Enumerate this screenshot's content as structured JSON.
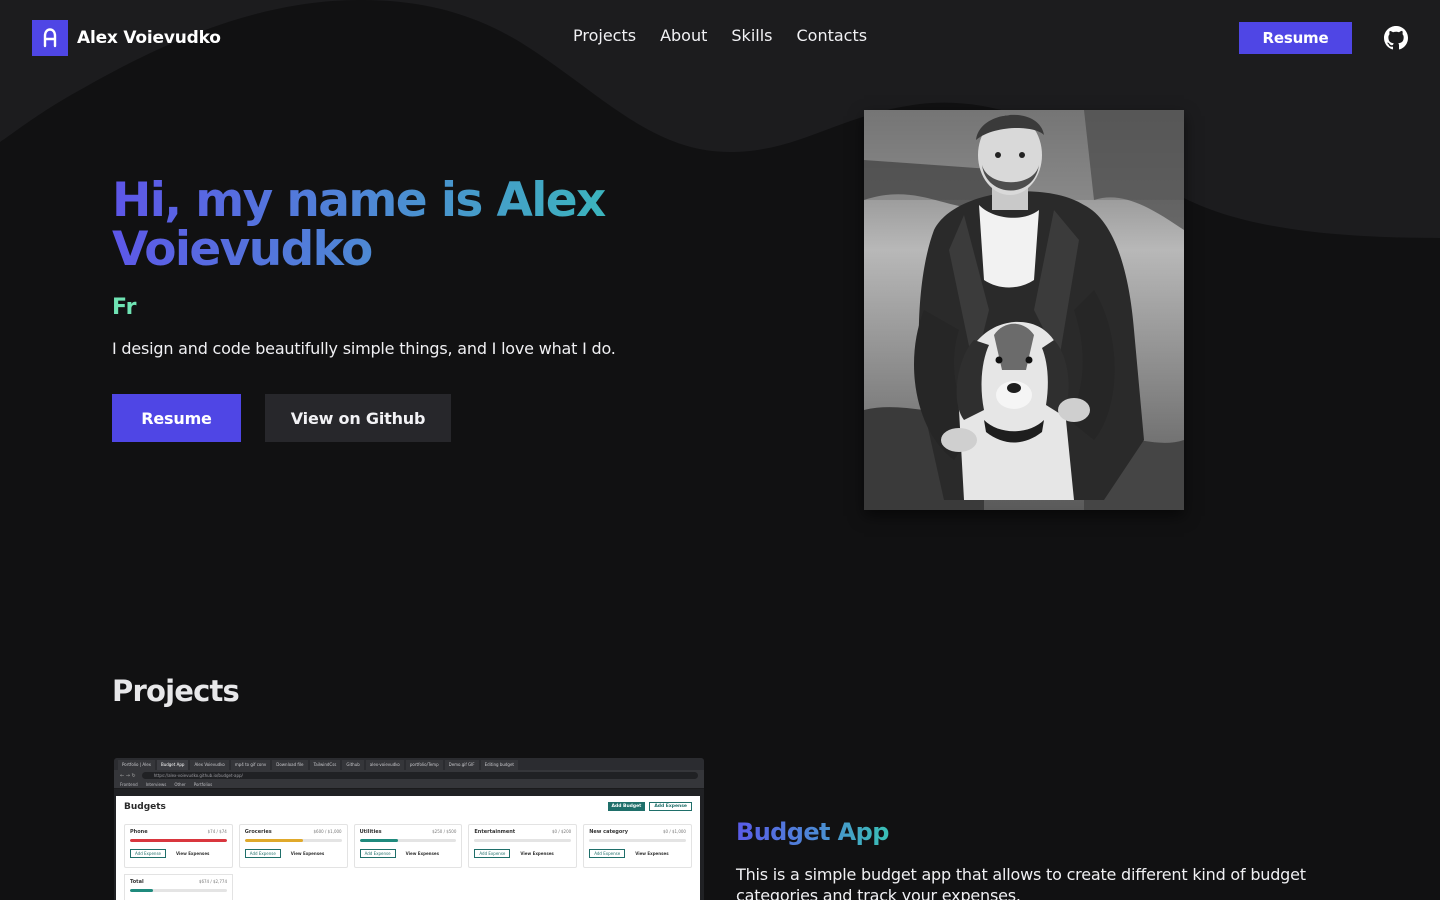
{
  "header": {
    "logo_mark": "A",
    "logo_text": "Alex Voievudko",
    "nav": [
      {
        "label": "Projects"
      },
      {
        "label": "About"
      },
      {
        "label": "Skills"
      },
      {
        "label": "Contacts"
      }
    ],
    "resume_label": "Resume",
    "github_icon": "github-icon"
  },
  "hero": {
    "title": "Hi, my name is Alex Voievudko",
    "typed_text": "Fr",
    "description": "I design and code beautifully simple things, and I love what I do.",
    "primary_button": "Resume",
    "secondary_button": "View on Github"
  },
  "projects": {
    "title": "Projects",
    "items": [
      {
        "name": "Budget App",
        "description": "This is a simple budget app that allows to create different kind of budget categories and track your expenses.",
        "screenshot": {
          "tabs": [
            "Portfolio | Alex",
            "Budget App",
            "Alex Voievudko",
            "mp4 to gif conv",
            "Download file",
            "TailwindCss",
            "Github",
            "alex-voievudko",
            "portfolio/Temp",
            "Demo.gif GIF",
            "Editing budget"
          ],
          "url": "https://alex-voievudko.github.io/budget-app/",
          "bookmarks": [
            "Frontend",
            "Interviews",
            "Other",
            "Portfolios"
          ],
          "page_title": "Budgets",
          "add_budget_label": "Add Budget",
          "add_expense_label": "Add Expense",
          "cards": [
            {
              "name": "Phone",
              "amount": "$74 / $74",
              "progress": 1.0
            },
            {
              "name": "Groceries",
              "amount": "$600 / $1,000",
              "progress": 0.6
            },
            {
              "name": "Utilities",
              "amount": "$250 / $500",
              "progress": 0.4
            },
            {
              "name": "Entertainment",
              "amount": "$0 / $200",
              "progress": 0.0
            },
            {
              "name": "New category",
              "amount": "$0 / $1,000",
              "progress": 0.0
            }
          ],
          "card_add_label": "Add Expense",
          "card_view_label": "View Expenses",
          "total": {
            "name": "Total",
            "amount": "$674 / $2,774",
            "progress": 0.24
          }
        }
      }
    ]
  },
  "colors": {
    "accent": "#4f46e5",
    "background": "#111112",
    "typed": "#6fe3b3",
    "gradient_start": "#5e55e9",
    "gradient_end": "#36c3b5"
  }
}
